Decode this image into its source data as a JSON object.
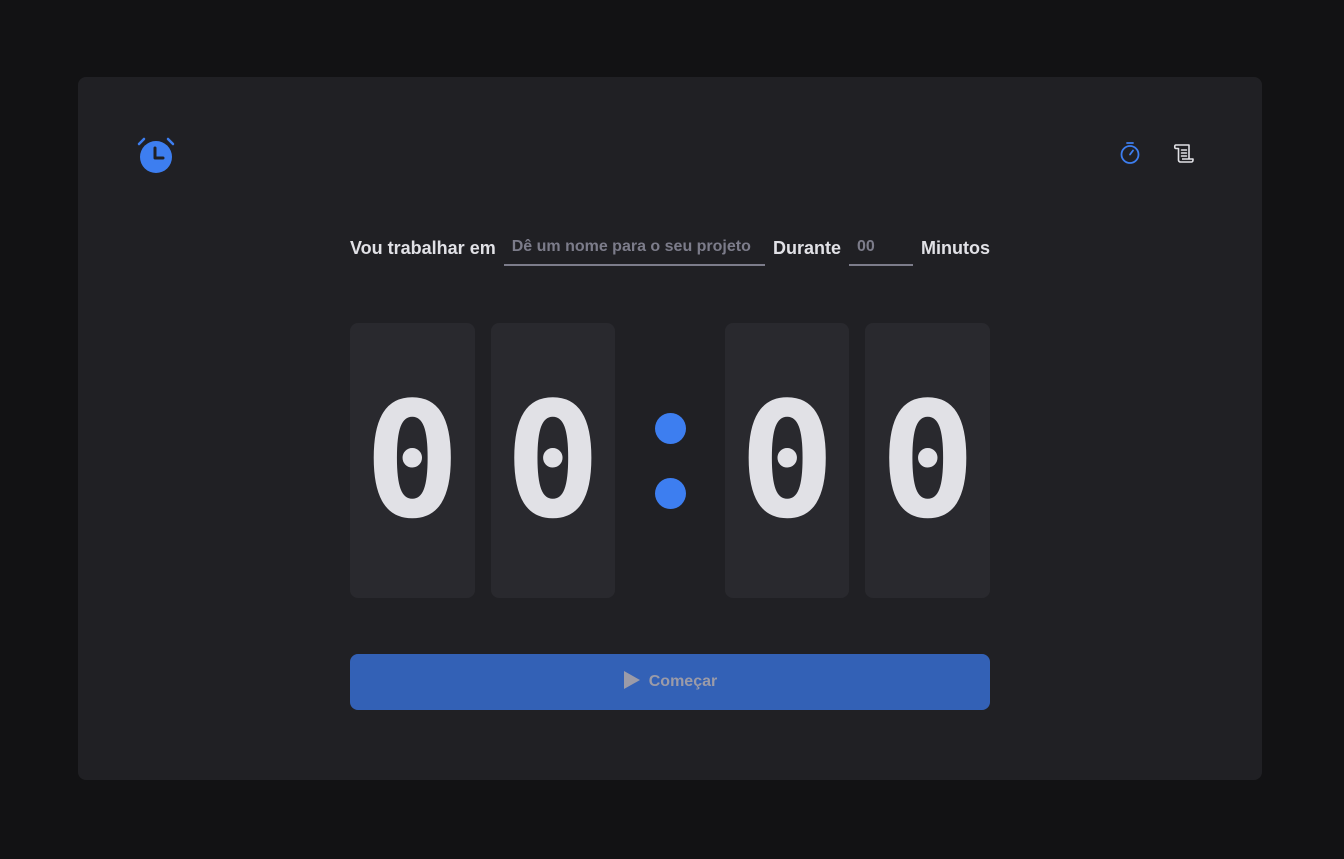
{
  "header": {
    "logo_icon": "alarm-clock-icon",
    "nav": [
      {
        "icon": "timer-icon",
        "active": true
      },
      {
        "icon": "scroll-icon",
        "active": false
      }
    ]
  },
  "form": {
    "task_label": "Vou trabalhar em",
    "task_placeholder": "Dê um nome para o seu projeto",
    "duration_label": "Durante",
    "minutes_placeholder": "00",
    "minutes_label": "Minutos"
  },
  "countdown": {
    "minutes_tens": "0",
    "minutes_ones": "0",
    "seconds_tens": "0",
    "seconds_ones": "0"
  },
  "start_button": {
    "label": "Começar",
    "icon": "play-icon",
    "disabled": true
  },
  "colors": {
    "accent": "#3d7ef0",
    "button": "#3361b6",
    "background": "#121214",
    "card": "#202024",
    "digit_bg": "#29292e",
    "text": "#e1e1e6"
  }
}
